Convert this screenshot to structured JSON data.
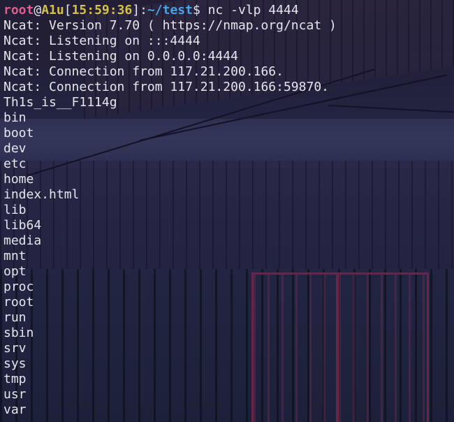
{
  "prompt": {
    "user": "root",
    "at": "@",
    "host": "A1u",
    "open_bracket": "[",
    "time": "15:59:36",
    "close_bracket": "]",
    "colon": ":",
    "path": "~/test",
    "sign": "$",
    "command": " nc -vlp 4444"
  },
  "output": [
    "Ncat: Version 7.70 ( https://nmap.org/ncat )",
    "Ncat: Listening on :::4444",
    "Ncat: Listening on 0.0.0.0:4444",
    "Ncat: Connection from 117.21.200.166.",
    "Ncat: Connection from 117.21.200.166:59870.",
    "Th1s_is__F1114g",
    "bin",
    "boot",
    "dev",
    "etc",
    "home",
    "index.html",
    "lib",
    "lib64",
    "media",
    "mnt",
    "opt",
    "proc",
    "root",
    "run",
    "sbin",
    "srv",
    "sys",
    "tmp",
    "usr",
    "var"
  ],
  "colors": {
    "user": "#e35d8c",
    "host_time": "#d4c14a",
    "path": "#4aa3e8",
    "text": "#e6e6ee",
    "gate_accent": "#8a2f5c"
  }
}
